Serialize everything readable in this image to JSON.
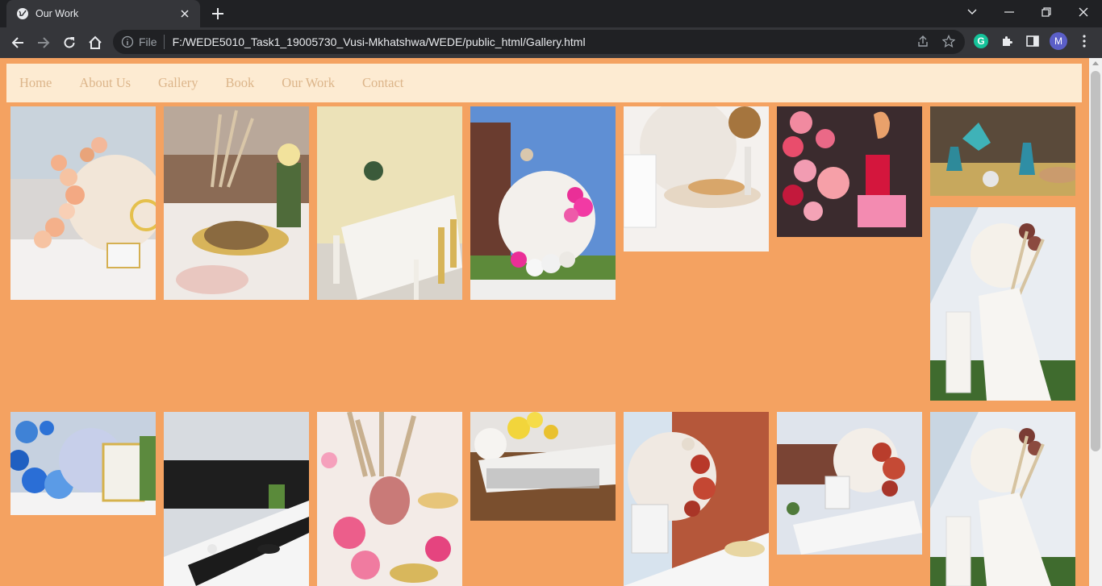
{
  "browser": {
    "tab_title": "Our Work",
    "url_scheme": "File",
    "url": "F:/WEDE5010_Task1_19005730_Vusi-Mkhatshwa/WEDE/public_html/Gallery.html",
    "profile_initial": "M",
    "grammarly_letter": "G"
  },
  "nav": {
    "items": [
      "Home",
      "About Us",
      "Gallery",
      "Book",
      "Our Work",
      "Contact"
    ]
  },
  "colors": {
    "page_background": "#f4a261",
    "nav_background": "#fdebd2",
    "nav_link": "#dcb58a"
  },
  "gallery": {
    "photos": [
      "peach-balloon-arch-oh-baby-chair",
      "pampas-grass-table-gold-napkin",
      "long-white-table-yellow-room",
      "pink-white-balloons-baby-shower-sign",
      "oh-baby-table-cutlery",
      "pink-red-balloons-number-30",
      "blue-glasses-table-setting",
      "white-tent-long-table-pampas",
      "blue-balloons-gold-chair",
      "black-white-table-runner",
      "pink-roses-pampas-centerpiece",
      "yellow-flowers-long-table",
      "oh-baby-red-balloons-white-chair",
      "oh-baby-outdoor-table-red-balloons",
      "white-tent-long-table-pampas-repeat"
    ]
  }
}
